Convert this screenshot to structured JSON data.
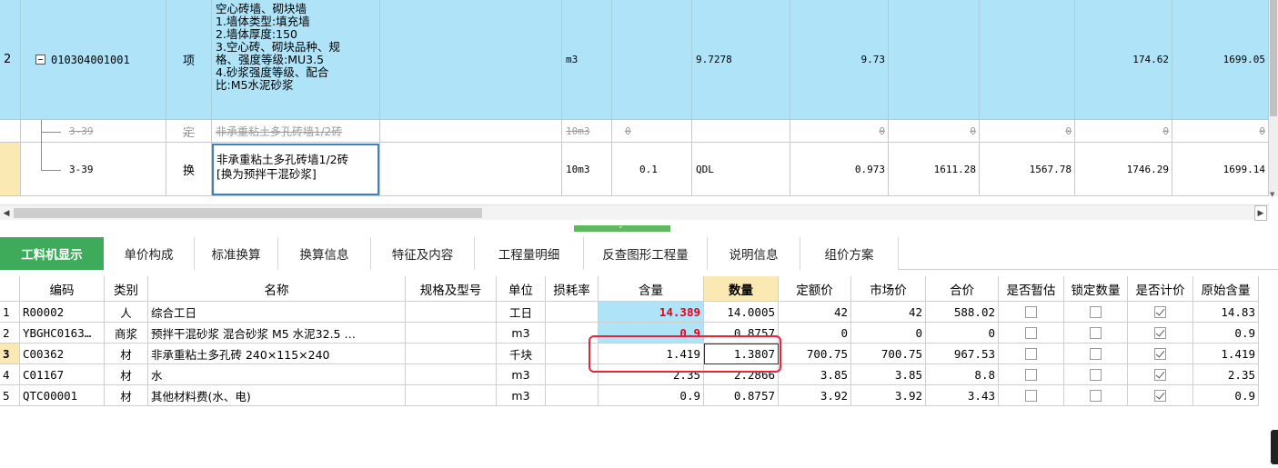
{
  "top": {
    "row_main": {
      "seq": "2",
      "code": "010304001001",
      "kind": "项",
      "name_lines": [
        "空心砖墙、砌块墙",
        "1.墙体类型:填充墙",
        "2.墙体厚度:150",
        "3.空心砖、砌块品种、规",
        "格、强度等级:MU3.5",
        "4.砂浆强度等级、配合",
        "比:M5水泥砂浆"
      ],
      "unit": "m3",
      "qty_expr": "9.7278",
      "qty": "9.73",
      "unit_price": "174.62",
      "total": "1699.05"
    },
    "row_strike": {
      "code": "3-39",
      "kind": "定",
      "name": "非承重粘土多孔砖墙1/2砖",
      "unit": "10m3",
      "c6": "0",
      "c9": "0",
      "c10": "0",
      "c11": "0",
      "c12": "0",
      "c13": "0"
    },
    "row_swap": {
      "code": "3-39",
      "kind": "换",
      "name_line1": "非承重粘土多孔砖墙1/2砖",
      "name_line2": "[换为预拌干混砂浆]",
      "unit": "10m3",
      "content": "0.1",
      "qty_expr": "QDL",
      "qty": "0.973",
      "c10": "1611.28",
      "c11": "1567.78",
      "c12": "1746.29",
      "c13": "1699.14"
    }
  },
  "tabs": [
    "工料机显示",
    "单价构成",
    "标准换算",
    "换算信息",
    "特征及内容",
    "工程量明细",
    "反查图形工程量",
    "说明信息",
    "组价方案"
  ],
  "bottom": {
    "headers": [
      "编码",
      "类别",
      "名称",
      "规格及型号",
      "单位",
      "损耗率",
      "含量",
      "数量",
      "定额价",
      "市场价",
      "合价",
      "是否暂估",
      "锁定数量",
      "是否计价",
      "原始含量"
    ],
    "rows": [
      {
        "idx": "1",
        "code": "R00002",
        "cat": "人",
        "name": "综合工日",
        "spec": "",
        "unit": "工日",
        "loss": "",
        "content": "14.389",
        "qty": "14.0005",
        "base": "42",
        "market": "42",
        "total": "588.02",
        "tmp": false,
        "lock": false,
        "priced": true,
        "orig": "14.83"
      },
      {
        "idx": "2",
        "code": "YBGHC0163…",
        "cat": "商浆",
        "name": "预拌干混砂浆 混合砂浆 M5 水泥32.5 …",
        "spec": "",
        "unit": "m3",
        "loss": "",
        "content": "0.9",
        "qty": "0.8757",
        "base": "0",
        "market": "0",
        "total": "0",
        "tmp": false,
        "lock": false,
        "priced": true,
        "orig": "0.9"
      },
      {
        "idx": "3",
        "code": "C00362",
        "cat": "材",
        "name": "非承重粘土多孔砖 240×115×240",
        "spec": "",
        "unit": "千块",
        "loss": "",
        "content": "1.419",
        "qty": "1.3807",
        "base": "700.75",
        "market": "700.75",
        "total": "967.53",
        "tmp": false,
        "lock": false,
        "priced": true,
        "orig": "1.419"
      },
      {
        "idx": "4",
        "code": "C01167",
        "cat": "材",
        "name": "水",
        "spec": "",
        "unit": "m3",
        "loss": "",
        "content": "2.35",
        "qty": "2.2866",
        "base": "3.85",
        "market": "3.85",
        "total": "8.8",
        "tmp": false,
        "lock": false,
        "priced": true,
        "orig": "2.35"
      },
      {
        "idx": "5",
        "code": "QTC00001",
        "cat": "材",
        "name": "其他材料费(水、电)",
        "spec": "",
        "unit": "m3",
        "loss": "",
        "content": "0.9",
        "qty": "0.8757",
        "base": "3.92",
        "market": "3.92",
        "total": "3.43",
        "tmp": false,
        "lock": false,
        "priced": true,
        "orig": "0.9"
      }
    ]
  },
  "colors": {
    "selected_row": "#aee3f8",
    "active_tab": "#3dab5a",
    "qty_header": "#fbe9b4",
    "annotation": "#e8233a"
  }
}
